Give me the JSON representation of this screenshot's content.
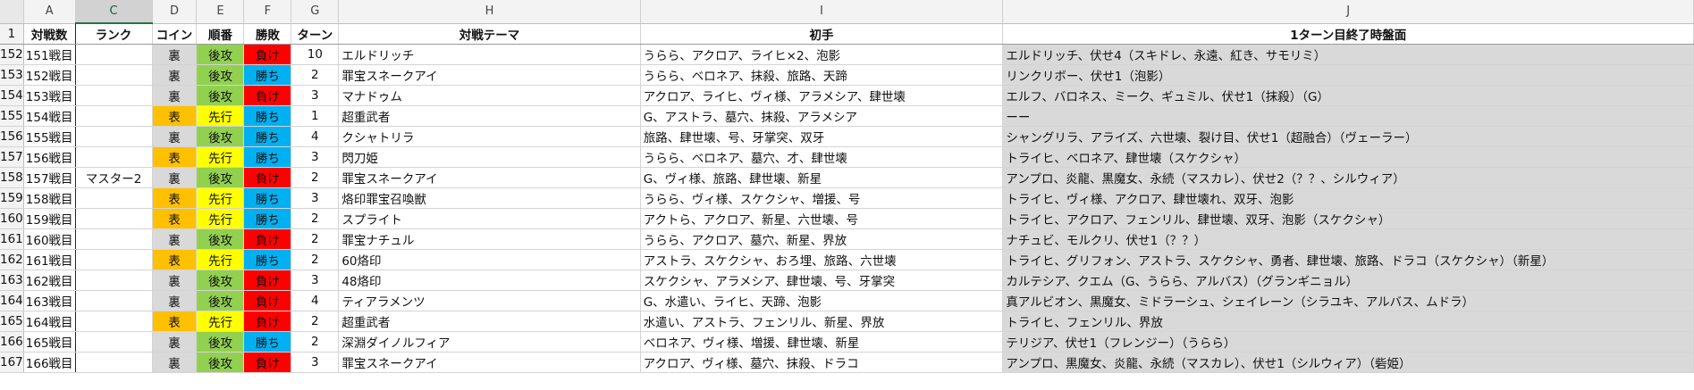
{
  "spreadsheet": {
    "column_letters": [
      "A",
      "C",
      "D",
      "E",
      "F",
      "G",
      "H",
      "I",
      "J"
    ],
    "selected_column": "C",
    "header_row": {
      "row_number": "1",
      "cells": [
        "対戦数",
        "ランク",
        "コイン",
        "順番",
        "勝敗",
        "ターン",
        "対戦テーマ",
        "初手",
        "1ターン目終了時盤面"
      ]
    },
    "rows": [
      {
        "row_number": "152",
        "match": "151戦目",
        "rank": "",
        "coin": "裏",
        "order": "後攻",
        "result": "負け",
        "turns": "10",
        "theme": "エルドリッチ",
        "opening": "うらら、アクロア、ライヒ×2、泡影",
        "board": "エルドリッチ、伏せ4（スキドレ、永遠、紅き、サモリミ）"
      },
      {
        "row_number": "153",
        "match": "152戦目",
        "rank": "",
        "coin": "裏",
        "order": "後攻",
        "result": "勝ち",
        "turns": "2",
        "theme": "罪宝スネークアイ",
        "opening": "うらら、ベロネア、抹殺、旅路、天蹄",
        "board": "リンクリボー、伏せ1（泡影）"
      },
      {
        "row_number": "154",
        "match": "153戦目",
        "rank": "",
        "coin": "裏",
        "order": "後攻",
        "result": "負け",
        "turns": "3",
        "theme": "マナドゥム",
        "opening": "アクロア、ライヒ、ヴィ様、アラメシア、肆世壊",
        "board": "エルフ、バロネス、ミーク、ギュミル、伏せ1（抹殺）（G）"
      },
      {
        "row_number": "155",
        "match": "154戦目",
        "rank": "",
        "coin": "表",
        "order": "先行",
        "result": "勝ち",
        "turns": "1",
        "theme": "超重武者",
        "opening": "G、アストラ、墓穴、抹殺、アラメシア",
        "board": "ーー"
      },
      {
        "row_number": "156",
        "match": "155戦目",
        "rank": "",
        "coin": "裏",
        "order": "後攻",
        "result": "勝ち",
        "turns": "4",
        "theme": "クシャトリラ",
        "opening": "旅路、肆世壊、号、牙掌突、双牙",
        "board": "シャングリラ、アライズ、六世壊、裂け目、伏せ1（超融合）（ヴェーラー）"
      },
      {
        "row_number": "157",
        "match": "156戦目",
        "rank": "",
        "coin": "表",
        "order": "先行",
        "result": "勝ち",
        "turns": "3",
        "theme": "閃刀姫",
        "opening": "うらら、ベロネア、墓穴、才、肆世壊",
        "board": "トライヒ、ベロネア、肆世壊（スケクシャ）"
      },
      {
        "row_number": "158",
        "match": "157戦目",
        "rank": "マスター2",
        "coin": "裏",
        "order": "後攻",
        "result": "負け",
        "turns": "2",
        "theme": "罪宝スネークアイ",
        "opening": "G、ヴィ様、旅路、肆世壊、新星",
        "board": "アンプロ、炎龍、黒魔女、永続（マスカレ）、伏せ2（？？、シルウィア）"
      },
      {
        "row_number": "159",
        "match": "158戦目",
        "rank": "",
        "coin": "表",
        "order": "先行",
        "result": "勝ち",
        "turns": "3",
        "theme": "烙印罪宝召喚獣",
        "opening": "うらら、ヴィ様、スケクシャ、増援、号",
        "board": "トライヒ、ヴィ様、アクロア、肆世壊れ、双牙、泡影"
      },
      {
        "row_number": "160",
        "match": "159戦目",
        "rank": "",
        "coin": "表",
        "order": "先行",
        "result": "勝ち",
        "turns": "2",
        "theme": "スプライト",
        "opening": "アクトら、アクロア、新星、六世壊、号",
        "board": "トライヒ、アクロア、フェンリル、肆世壊、双牙、泡影（スケクシャ）"
      },
      {
        "row_number": "161",
        "match": "160戦目",
        "rank": "",
        "coin": "裏",
        "order": "後攻",
        "result": "負け",
        "turns": "2",
        "theme": "罪宝ナチュル",
        "opening": "うらら、アクロア、墓穴、新星、界放",
        "board": "ナチュビ、モルクリ、伏せ1（？？）"
      },
      {
        "row_number": "162",
        "match": "161戦目",
        "rank": "",
        "coin": "表",
        "order": "先行",
        "result": "勝ち",
        "turns": "2",
        "theme": "60烙印",
        "opening": "アストラ、スケクシャ、おろ埋、旅路、六世壊",
        "board": "トライヒ、グリフォン、アストラ、スケクシャ、勇者、肆世壊、旅路、ドラコ（スケクシャ）（新星）"
      },
      {
        "row_number": "163",
        "match": "162戦目",
        "rank": "",
        "coin": "裏",
        "order": "後攻",
        "result": "負け",
        "turns": "3",
        "theme": "48烙印",
        "opening": "スケクシャ、アラメシア、肆世壊、号、牙掌突",
        "board": "カルテシア、クエム（G、うらら、アルバス）（グランギニョル）"
      },
      {
        "row_number": "164",
        "match": "163戦目",
        "rank": "",
        "coin": "裏",
        "order": "後攻",
        "result": "負け",
        "turns": "4",
        "theme": "ティアラメンツ",
        "opening": "G、水遣い、ライヒ、天蹄、泡影",
        "board": "真アルビオン、黒魔女、ミドラーシュ、シェイレーン（シラユキ、アルバス、ムドラ）"
      },
      {
        "row_number": "165",
        "match": "164戦目",
        "rank": "",
        "coin": "表",
        "order": "先行",
        "result": "負け",
        "turns": "2",
        "theme": "超重武者",
        "opening": "水遣い、アストラ、フェンリル、新星、界放",
        "board": "トライヒ、フェンリル、界放"
      },
      {
        "row_number": "166",
        "match": "165戦目",
        "rank": "",
        "coin": "裏",
        "order": "後攻",
        "result": "勝ち",
        "turns": "2",
        "theme": "深淵ダイノルフィア",
        "opening": "ベロネア、ヴィ様、増援、肆世壊、新星",
        "board": "テリジア、伏せ1（フレンジー）（うらら）"
      },
      {
        "row_number": "167",
        "match": "166戦目",
        "rank": "",
        "coin": "裏",
        "order": "後攻",
        "result": "負け",
        "turns": "3",
        "theme": "罪宝スネークアイ",
        "opening": "アクロア、ヴィ様、墓穴、抹殺、ドラコ",
        "board": "アンプロ、黒魔女、炎龍、永続（マスカレ）、伏せ1（シルウィア）（砦姫）"
      }
    ]
  },
  "colors": {
    "coin_ura": "#d9d9d9",
    "coin_omote": "#ffc000",
    "order_go": "#92d050",
    "order_sen": "#ffff00",
    "result_win": "#00b0f0",
    "result_lose": "#ff0000",
    "board_fill": "#d9d9d9"
  }
}
